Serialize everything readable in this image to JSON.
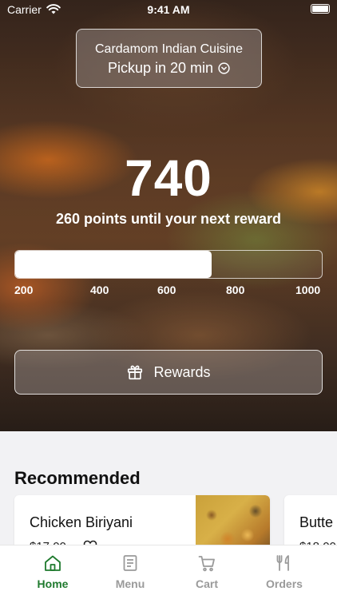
{
  "status_bar": {
    "carrier": "Carrier",
    "time": "9:41 AM"
  },
  "pickup": {
    "restaurant": "Cardamom Indian Cuisine",
    "pickup_text": "Pickup in 20 min"
  },
  "rewards": {
    "points": "740",
    "caption": "260 points until your next reward",
    "progress_fraction": 0.64,
    "ticks": [
      "200",
      "400",
      "600",
      "800",
      "1000"
    ],
    "button_label": "Rewards"
  },
  "recommended": {
    "title": "Recommended",
    "items": [
      {
        "name": "Chicken Biriyani",
        "price": "$17.00"
      },
      {
        "name": "Butte",
        "price": "$18.00"
      }
    ]
  },
  "tabs": [
    {
      "label": "Home",
      "icon": "home-icon",
      "active": true
    },
    {
      "label": "Menu",
      "icon": "menu-icon",
      "active": false
    },
    {
      "label": "Cart",
      "icon": "cart-icon",
      "active": false
    },
    {
      "label": "Orders",
      "icon": "orders-icon",
      "active": false
    }
  ],
  "colors": {
    "accent": "#1f7a2e",
    "inactive_tab": "#9a9a9a"
  }
}
